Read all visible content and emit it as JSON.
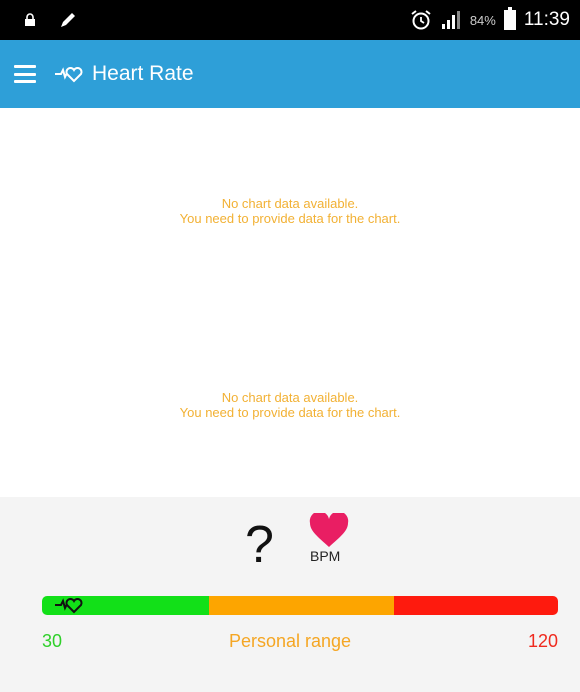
{
  "status_bar": {
    "battery": "84%",
    "time": "11:39",
    "icons": [
      "lock-icon",
      "edit-pen-icon",
      "alarm-icon",
      "signal-icon",
      "battery-icon"
    ]
  },
  "app_bar": {
    "title": "Heart Rate",
    "icons": [
      "menu-icon",
      "heart-rate-icon"
    ],
    "color": "#2e9fd8"
  },
  "charts": [
    {
      "empty_line1": "No chart data available.",
      "empty_line2": "You need to provide data for the chart."
    },
    {
      "empty_line1": "No chart data available.",
      "empty_line2": "You need to provide data for the chart."
    }
  ],
  "reading": {
    "value": "?",
    "unit": "BPM",
    "icon": "heart-icon",
    "heart_color": "#e91e63"
  },
  "range": {
    "min": "30",
    "label": "Personal range",
    "max": "120",
    "colors": {
      "low": "#12e018",
      "mid": "#fda500",
      "high": "#fe1a0e"
    }
  }
}
